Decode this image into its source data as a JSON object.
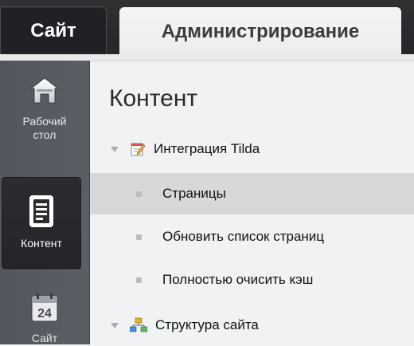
{
  "tabs": {
    "site": "Сайт",
    "admin": "Администрирование"
  },
  "sidebar": {
    "items": [
      {
        "label": "Рабочий стол",
        "icon": "home-icon"
      },
      {
        "label": "Контент",
        "icon": "document-icon",
        "active": true
      },
      {
        "label": "Сайт",
        "icon": "calendar-icon",
        "icon_text": "24"
      }
    ]
  },
  "main": {
    "title": "Контент",
    "tree": [
      {
        "label": "Интеграция Tilda",
        "icon": "edit-note-icon",
        "expanded": true
      },
      {
        "label": "Страницы",
        "selected": true
      },
      {
        "label": "Обновить список страниц"
      },
      {
        "label": "Полностью очисить кэш"
      },
      {
        "label": "Структура сайта",
        "icon": "sitemap-icon",
        "expanded": true
      }
    ]
  },
  "colors": {
    "topbar": "#2a2c30",
    "sidebar": "#565a61",
    "selected_row": "#d6d8da",
    "background": "#f1f2f3"
  }
}
